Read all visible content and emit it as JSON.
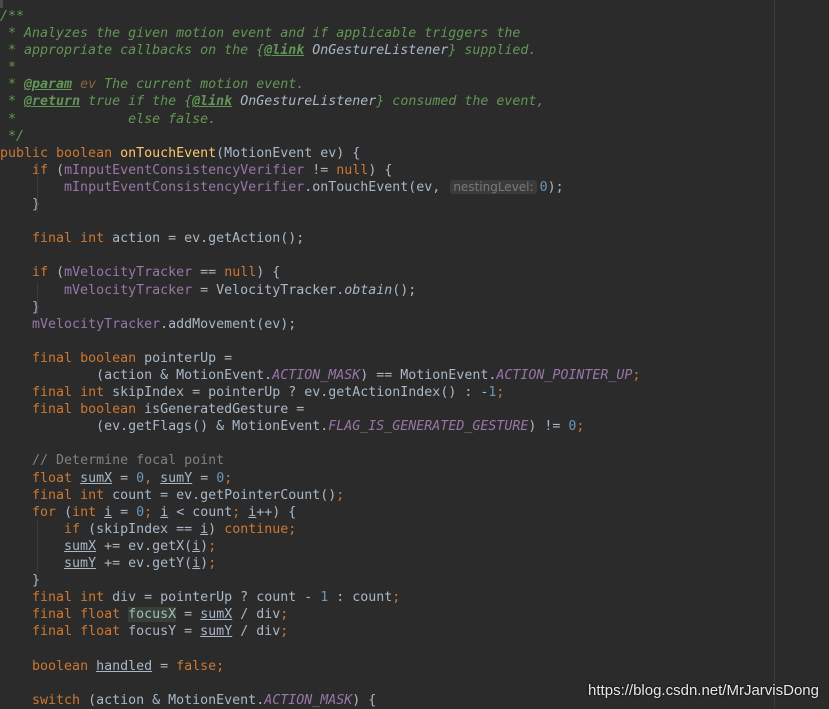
{
  "code_lines": [
    [
      [
        "doc",
        "/**"
      ]
    ],
    [
      [
        "doc",
        " * Analyzes the given motion event and if applicable triggers the"
      ]
    ],
    [
      [
        "doc",
        " * appropriate callbacks on the {"
      ],
      [
        "doclink",
        "@link"
      ],
      [
        "docref",
        " OnGestureListener"
      ],
      [
        "doc",
        "} supplied."
      ]
    ],
    [
      [
        "doc",
        " *"
      ]
    ],
    [
      [
        "doc",
        " * "
      ],
      [
        "doctag",
        "@param"
      ],
      [
        "docparam",
        " ev"
      ],
      [
        "doc",
        " The current motion event."
      ]
    ],
    [
      [
        "doc",
        " * "
      ],
      [
        "doctag",
        "@return"
      ],
      [
        "doc",
        " true if the {"
      ],
      [
        "doclink",
        "@link"
      ],
      [
        "docref",
        " OnGestureListener"
      ],
      [
        "doc",
        "} consumed the event,"
      ]
    ],
    [
      [
        "doc",
        " *              else false."
      ]
    ],
    [
      [
        "doc",
        " */"
      ]
    ],
    [
      [
        "keyword",
        "public boolean "
      ],
      [
        "method",
        "onTouchEvent"
      ],
      [
        "plain",
        "(MotionEvent ev) {"
      ]
    ],
    [
      [
        "plain",
        "    "
      ],
      [
        "keyword",
        "if "
      ],
      [
        "plain",
        "("
      ],
      [
        "field",
        "mInputEventConsistencyVerifier"
      ],
      [
        "plain",
        " != "
      ],
      [
        "keyword",
        "null"
      ],
      [
        "plain",
        ") {"
      ]
    ],
    [
      [
        "plain",
        "        "
      ],
      [
        "field",
        "mInputEventConsistencyVerifier"
      ],
      [
        "plain",
        ".onTouchEvent(ev, "
      ],
      [
        "hint",
        "nestingLevel:"
      ],
      [
        "number",
        "0"
      ],
      [
        "plain",
        ");"
      ]
    ],
    [
      [
        "plain",
        "    }"
      ]
    ],
    [],
    [
      [
        "plain",
        "    "
      ],
      [
        "keyword",
        "final int "
      ],
      [
        "plain",
        "action = ev.getAction();"
      ]
    ],
    [],
    [
      [
        "plain",
        "    "
      ],
      [
        "keyword",
        "if "
      ],
      [
        "plain",
        "("
      ],
      [
        "field",
        "mVelocityTracker"
      ],
      [
        "plain",
        " == "
      ],
      [
        "keyword",
        "null"
      ],
      [
        "plain",
        ") {"
      ]
    ],
    [
      [
        "plain",
        "        "
      ],
      [
        "field",
        "mVelocityTracker"
      ],
      [
        "plain",
        " = VelocityTracker."
      ],
      [
        "staticmethod",
        "obtain"
      ],
      [
        "plain",
        "();"
      ]
    ],
    [
      [
        "plain",
        "    }"
      ]
    ],
    [
      [
        "plain",
        "    "
      ],
      [
        "field",
        "mVelocityTracker"
      ],
      [
        "plain",
        ".addMovement(ev);"
      ]
    ],
    [],
    [
      [
        "plain",
        "    "
      ],
      [
        "keyword",
        "final boolean "
      ],
      [
        "plain",
        "pointerUp ="
      ]
    ],
    [
      [
        "plain",
        "            (action & MotionEvent."
      ],
      [
        "static",
        "ACTION_MASK"
      ],
      [
        "plain",
        ") == MotionEvent."
      ],
      [
        "static",
        "ACTION_POINTER_UP"
      ],
      [
        "keyword",
        ";"
      ]
    ],
    [
      [
        "plain",
        "    "
      ],
      [
        "keyword",
        "final int "
      ],
      [
        "plain",
        "skipIndex = pointerUp ? ev.getActionIndex() : -"
      ],
      [
        "number",
        "1"
      ],
      [
        "keyword",
        ";"
      ]
    ],
    [
      [
        "plain",
        "    "
      ],
      [
        "keyword",
        "final boolean "
      ],
      [
        "plain",
        "isGeneratedGesture ="
      ]
    ],
    [
      [
        "plain",
        "            (ev.getFlags() & MotionEvent."
      ],
      [
        "static",
        "FLAG_IS_GENERATED_GESTURE"
      ],
      [
        "plain",
        ") != "
      ],
      [
        "number",
        "0"
      ],
      [
        "keyword",
        ";"
      ]
    ],
    [],
    [
      [
        "plain",
        "    "
      ],
      [
        "comment",
        "// Determine focal point"
      ]
    ],
    [
      [
        "plain",
        "    "
      ],
      [
        "keyword",
        "float "
      ],
      [
        "ul",
        "sumX"
      ],
      [
        "plain",
        " = "
      ],
      [
        "number",
        "0"
      ],
      [
        "keyword",
        ", "
      ],
      [
        "ul",
        "sumY"
      ],
      [
        "plain",
        " = "
      ],
      [
        "number",
        "0"
      ],
      [
        "keyword",
        ";"
      ]
    ],
    [
      [
        "plain",
        "    "
      ],
      [
        "keyword",
        "final int "
      ],
      [
        "plain",
        "count = ev.getPointerCount()"
      ],
      [
        "keyword",
        ";"
      ]
    ],
    [
      [
        "plain",
        "    "
      ],
      [
        "keyword",
        "for "
      ],
      [
        "plain",
        "("
      ],
      [
        "keyword",
        "int "
      ],
      [
        "ul",
        "i"
      ],
      [
        "plain",
        " = "
      ],
      [
        "number",
        "0"
      ],
      [
        "keyword",
        "; "
      ],
      [
        "ul",
        "i"
      ],
      [
        "plain",
        " < count"
      ],
      [
        "keyword",
        "; "
      ],
      [
        "ul",
        "i"
      ],
      [
        "plain",
        "++) {"
      ]
    ],
    [
      [
        "plain",
        "        "
      ],
      [
        "keyword",
        "if "
      ],
      [
        "plain",
        "(skipIndex == "
      ],
      [
        "ul",
        "i"
      ],
      [
        "plain",
        ") "
      ],
      [
        "keyword",
        "continue;"
      ]
    ],
    [
      [
        "plain",
        "        "
      ],
      [
        "ul",
        "sumX"
      ],
      [
        "plain",
        " += ev.getX("
      ],
      [
        "ul",
        "i"
      ],
      [
        "plain",
        ")"
      ],
      [
        "keyword",
        ";"
      ]
    ],
    [
      [
        "plain",
        "        "
      ],
      [
        "ul",
        "sumY"
      ],
      [
        "plain",
        " += ev.getY("
      ],
      [
        "ul",
        "i"
      ],
      [
        "plain",
        ")"
      ],
      [
        "keyword",
        ";"
      ]
    ],
    [
      [
        "plain",
        "    }"
      ]
    ],
    [
      [
        "plain",
        "    "
      ],
      [
        "keyword",
        "final int "
      ],
      [
        "plain",
        "div = pointerUp ? count - "
      ],
      [
        "number",
        "1"
      ],
      [
        "plain",
        " : count"
      ],
      [
        "keyword",
        ";"
      ]
    ],
    [
      [
        "plain",
        "    "
      ],
      [
        "keyword",
        "final float "
      ],
      [
        "hl",
        "focusX"
      ],
      [
        "plain",
        " = "
      ],
      [
        "ul",
        "sumX"
      ],
      [
        "plain",
        " / div"
      ],
      [
        "keyword",
        ";"
      ]
    ],
    [
      [
        "plain",
        "    "
      ],
      [
        "keyword",
        "final float "
      ],
      [
        "plain",
        "focusY = "
      ],
      [
        "ul",
        "sumY"
      ],
      [
        "plain",
        " / div"
      ],
      [
        "keyword",
        ";"
      ]
    ],
    [],
    [
      [
        "plain",
        "    "
      ],
      [
        "keyword",
        "boolean "
      ],
      [
        "ul",
        "handled"
      ],
      [
        "plain",
        " = "
      ],
      [
        "keyword",
        "false;"
      ]
    ],
    [],
    [
      [
        "plain",
        "    "
      ],
      [
        "keyword",
        "switch "
      ],
      [
        "plain",
        "(action & MotionEvent."
      ],
      [
        "static",
        "ACTION_MASK"
      ],
      [
        "plain",
        ") {"
      ]
    ]
  ],
  "watermark": "https://blog.csdn.net/MrJarvisDong"
}
